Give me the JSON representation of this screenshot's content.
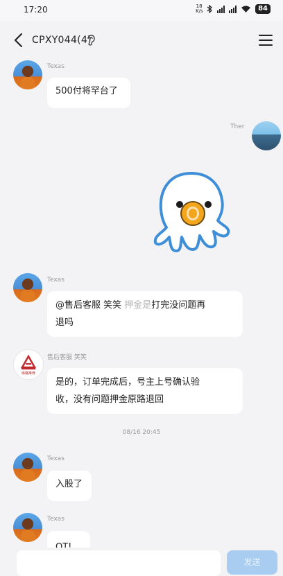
{
  "status": {
    "time": "17:20",
    "net_speed": "18 K/s",
    "battery": "84"
  },
  "header": {
    "title": "CPXY044(4)"
  },
  "messages": [
    {
      "sender": "Texas",
      "text": "500付将罕台了"
    },
    {
      "sender": "Ther"
    },
    {
      "sender": "Texas",
      "mention": "@售后客服 笑笑",
      "faded": "押金是",
      "text_tail": "打完没问题再",
      "text2": "退吗"
    },
    {
      "sender": "售后客服 笑笑",
      "avatar_caption": "缘路推荐",
      "line1": "是的，订单完成后，号主上号确认验",
      "line2": "收，没有问题押金原路退回"
    },
    {
      "sender": "Texas",
      "text": "入股了"
    },
    {
      "sender": "Texas",
      "text": "OT!"
    }
  ],
  "timestamp": "08/16 20:45",
  "composer": {
    "send_label": "发送",
    "placeholder": ""
  },
  "icons": {
    "back": "chevron-left-icon",
    "ear": "ear-icon",
    "menu": "hamburger-menu-icon"
  },
  "colors": {
    "background": "#f3f3f5",
    "bubble": "#ffffff",
    "send_button": "#a9cdf0"
  }
}
